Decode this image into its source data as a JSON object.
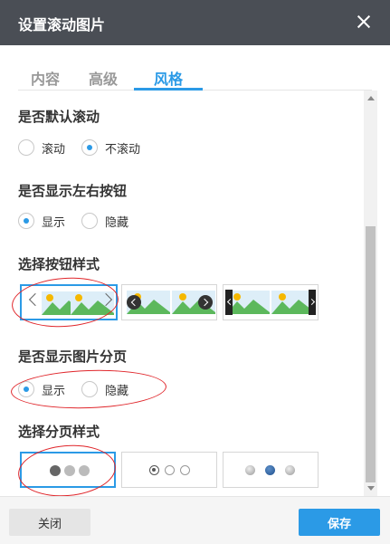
{
  "dialog": {
    "title": "设置滚动图片",
    "close_icon": "close-icon"
  },
  "tabs": [
    {
      "label": "内容",
      "active": false
    },
    {
      "label": "高级",
      "active": false
    },
    {
      "label": "风格",
      "active": true
    }
  ],
  "sections": {
    "auto_scroll": {
      "title": "是否默认滚动",
      "options": [
        {
          "label": "滚动",
          "checked": false
        },
        {
          "label": "不滚动",
          "checked": true
        }
      ]
    },
    "show_arrows": {
      "title": "是否显示左右按钮",
      "options": [
        {
          "label": "显示",
          "checked": true
        },
        {
          "label": "隐藏",
          "checked": false
        }
      ]
    },
    "button_style": {
      "title": "选择按钮样式",
      "selected_index": 0,
      "styles": [
        "thin-chevron-arrows",
        "round-dark-arrows",
        "square-dark-arrows"
      ]
    },
    "show_pagination": {
      "title": "是否显示图片分页",
      "options": [
        {
          "label": "显示",
          "checked": true
        },
        {
          "label": "隐藏",
          "checked": false
        }
      ]
    },
    "pagination_style": {
      "title": "选择分页样式",
      "selected_index": 0,
      "styles": [
        "filled-dots",
        "hollow-circle-dots",
        "shaded-dots"
      ]
    }
  },
  "footer": {
    "close_label": "关闭",
    "save_label": "保存"
  },
  "colors": {
    "titlebar": "#4a4e55",
    "accent": "#2b9ae6",
    "annotation": "#e0262b",
    "sky": "#ddeef8",
    "hill": "#5cb85c",
    "sun": "#f5b800"
  }
}
